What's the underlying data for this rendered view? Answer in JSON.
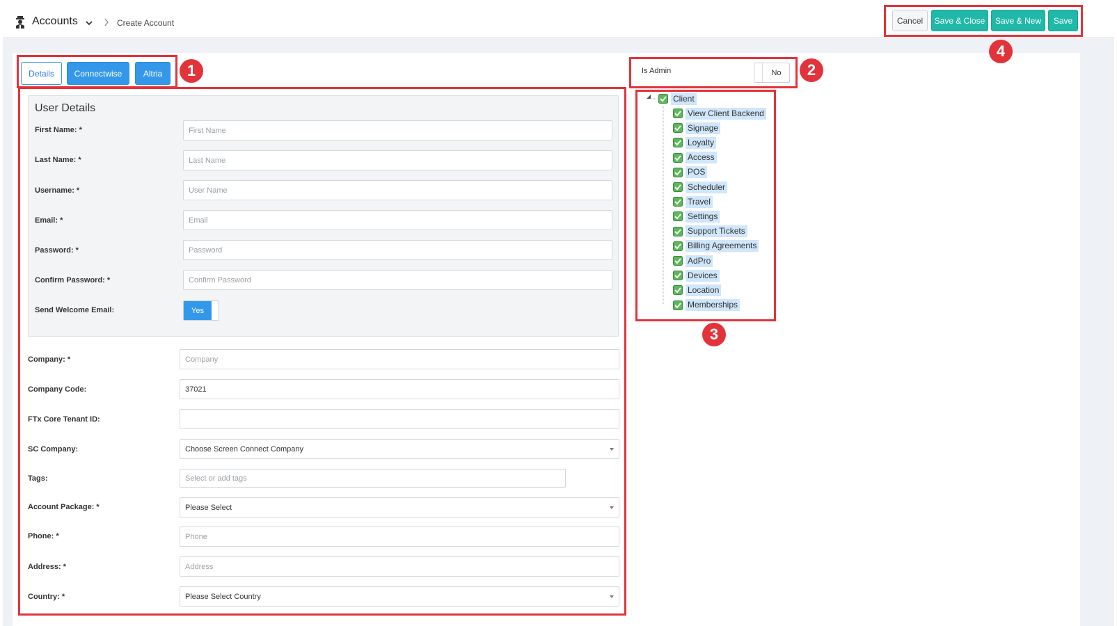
{
  "header": {
    "title": "Accounts",
    "breadcrumb_current": "Create Account",
    "buttons": {
      "cancel": "Cancel",
      "save_close": "Save & Close",
      "save_new": "Save & New",
      "save": "Save"
    }
  },
  "tabs": [
    "Details",
    "Connectwise",
    "Altria"
  ],
  "markers": [
    "1",
    "2",
    "3",
    "4"
  ],
  "user_details": {
    "title": "User Details",
    "first_name": {
      "label": "First Name: *",
      "placeholder": "First Name",
      "value": ""
    },
    "last_name": {
      "label": "Last Name: *",
      "placeholder": "Last Name",
      "value": ""
    },
    "username": {
      "label": "Username: *",
      "placeholder": "User Name",
      "value": ""
    },
    "email": {
      "label": "Email: *",
      "placeholder": "Email",
      "value": ""
    },
    "password": {
      "label": "Password: *",
      "placeholder": "Password",
      "value": ""
    },
    "confirm_password": {
      "label": "Confirm Password: *",
      "placeholder": "Confirm Password",
      "value": ""
    },
    "send_welcome": {
      "label": "Send Welcome Email:",
      "value": "Yes"
    }
  },
  "company": {
    "company": {
      "label": "Company: *",
      "placeholder": "Company",
      "value": ""
    },
    "company_code": {
      "label": "Company Code:",
      "value": "37021"
    },
    "tenant_id": {
      "label": "FTx Core Tenant ID:",
      "value": ""
    },
    "sc_company": {
      "label": "SC Company:",
      "selected": "Choose Screen Connect Company"
    },
    "tags": {
      "label": "Tags:",
      "placeholder": "Select or add tags"
    },
    "account_package": {
      "label": "Account Package: *",
      "selected": "Please Select"
    },
    "phone": {
      "label": "Phone: *",
      "placeholder": "Phone",
      "value": ""
    },
    "address": {
      "label": "Address: *",
      "placeholder": "Address",
      "value": ""
    },
    "country": {
      "label": "Country: *",
      "selected": "Please Select Country"
    }
  },
  "is_admin": {
    "label": "Is Admin",
    "value": "No"
  },
  "permissions": {
    "root": "Client",
    "children": [
      "View Client Backend",
      "Signage",
      "Loyalty",
      "Access",
      "POS",
      "Scheduler",
      "Travel",
      "Settings",
      "Support Tickets",
      "Billing Agreements",
      "AdPro",
      "Devices",
      "Location",
      "Memberships"
    ]
  },
  "colors": {
    "accent_blue": "#3498ea",
    "teal": "#20b8a8",
    "annotation_red": "#e3333a",
    "tree_highlight": "#cfe6fb"
  }
}
